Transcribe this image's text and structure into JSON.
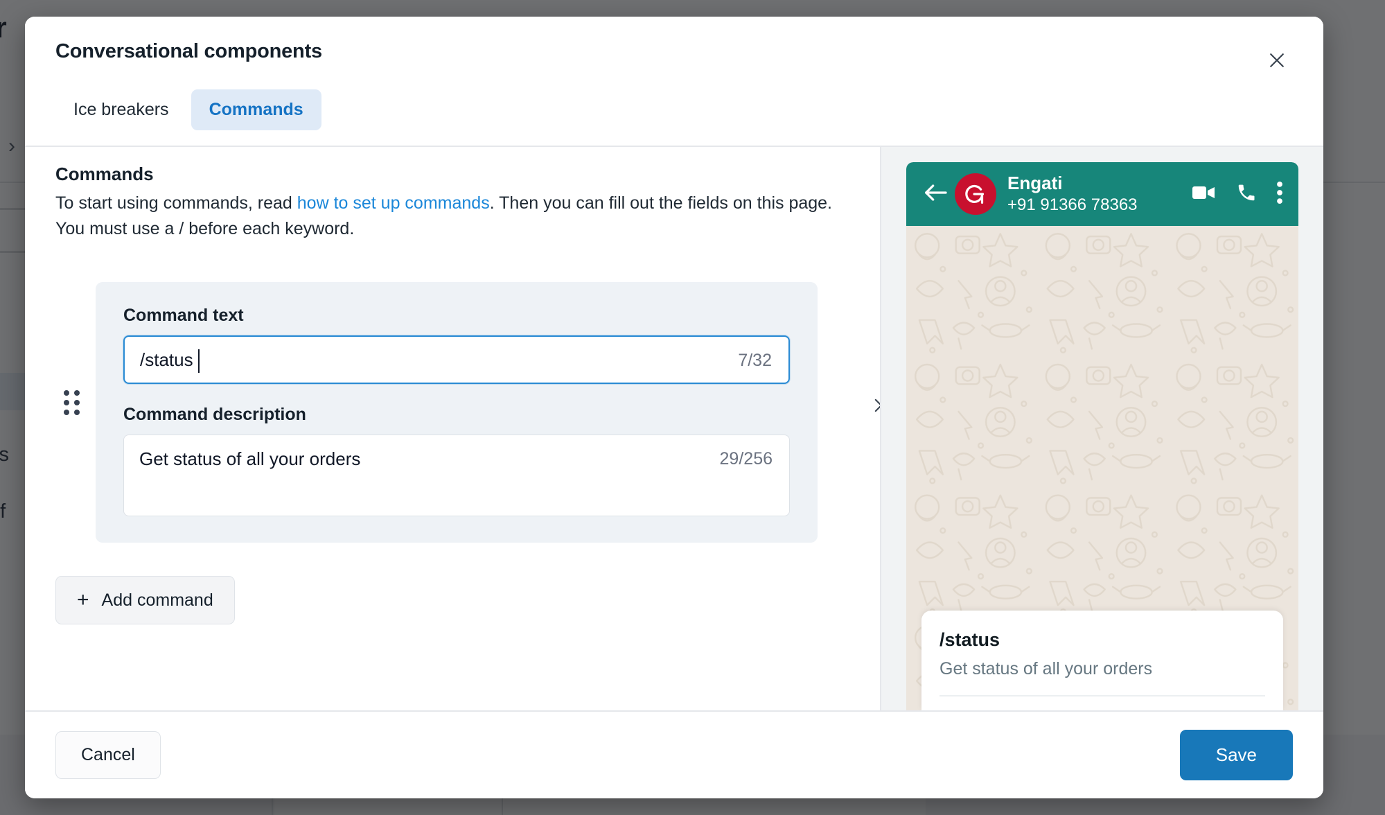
{
  "background": {
    "title_fragment": "er",
    "chevron": "›",
    "side_items": [
      {
        "label": "s",
        "active": true
      },
      {
        "label": "ks",
        "active": false
      },
      {
        "label": "rif",
        "active": false
      }
    ]
  },
  "modal": {
    "title": "Conversational components",
    "close_icon": "close-icon",
    "tabs": [
      {
        "label": "Ice breakers",
        "active": false
      },
      {
        "label": "Commands",
        "active": true
      }
    ]
  },
  "commands_section": {
    "heading": "Commands",
    "desc_part1": "To start using commands, read ",
    "link_text": "how to set up commands",
    "desc_part2": ". Then you can fill out the fields on this page. You must use a / before each keyword.",
    "add_button_label": "Add command",
    "add_button_icon": "plus-icon",
    "drag_handle_icon": "drag-handle-icon",
    "remove_icon": "close-icon"
  },
  "command_row": {
    "command_text_label": "Command text",
    "command_text_value": "/status",
    "command_text_counter": "7/32",
    "command_description_label": "Command description",
    "command_description_value": "Get status of all your orders",
    "command_description_counter": "29/256"
  },
  "preview": {
    "back_icon": "arrow-left-icon",
    "avatar_icon": "engati-logo-icon",
    "contact_name": "Engati",
    "contact_phone": "+91 91366 78363",
    "video_icon": "video-camera-icon",
    "call_icon": "phone-icon",
    "menu_icon": "more-vertical-icon",
    "card_title": "/status",
    "card_description": "Get status of all your orders"
  },
  "footer": {
    "cancel_label": "Cancel",
    "save_label": "Save"
  },
  "colors": {
    "accent_blue": "#1878b9",
    "link_blue": "#1b87d9",
    "tab_active_bg": "#dfeaf7",
    "whatsapp_green": "#17867a",
    "avatar_red": "#c8102e",
    "wallpaper": "#ece5dd"
  }
}
